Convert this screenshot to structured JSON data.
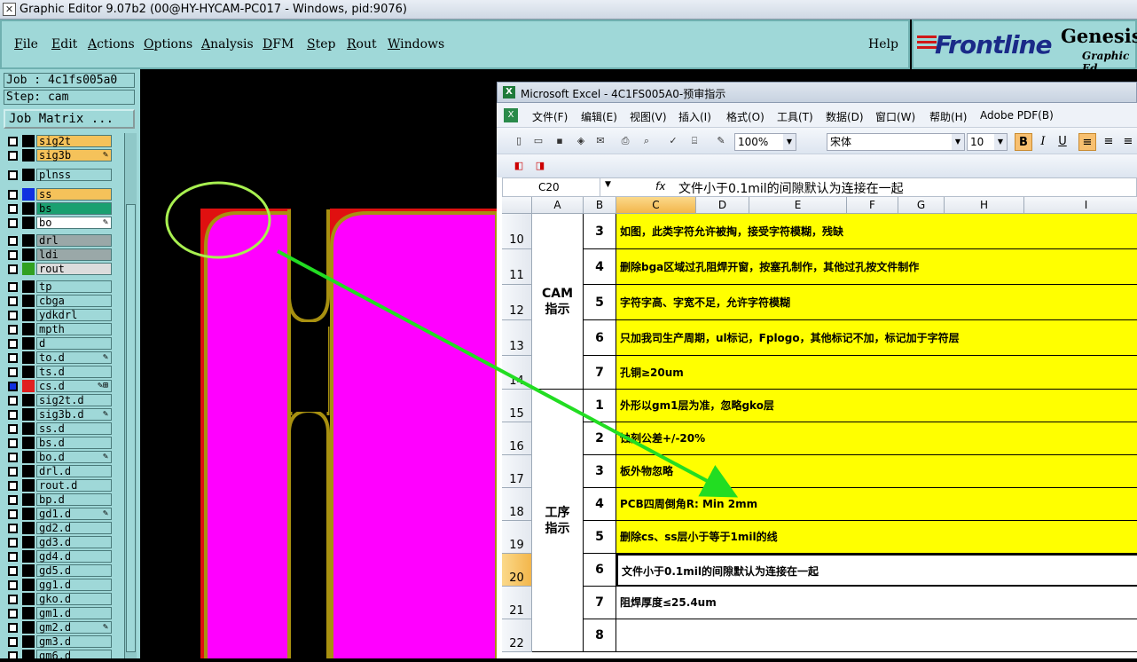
{
  "window_title": "Graphic Editor 9.07b2 (00@HY-HYCAM-PC017 - Windows, pid:9076)",
  "genesis_menu": [
    "File",
    "Edit",
    "Actions",
    "Options",
    "Analysis",
    "DFM",
    "Step",
    "Rout",
    "Windows"
  ],
  "help_label": "Help",
  "logo": {
    "brand": "Frontline",
    "product": "Genesis",
    "subtitle": "Graphic Ed"
  },
  "job_label": "Job : 4c1fs005a0",
  "step_label": "Step: cam",
  "job_matrix_label": "Job Matrix ...",
  "layers": [
    {
      "name": "sig2t",
      "color": "#000000",
      "bg": "#f5c25a",
      "mark": ""
    },
    {
      "name": "sig3b",
      "color": "#000000",
      "bg": "#f5c25a",
      "mark": "✎"
    },
    {
      "name": "plnss",
      "color": "#000000",
      "bg": "#9fd8d8",
      "mark": ""
    },
    {
      "name": "ss",
      "color": "#1030e0",
      "bg": "#f5c25a",
      "mark": ""
    },
    {
      "name": "bs",
      "color": "#000000",
      "bg": "#1aa070",
      "mark": ""
    },
    {
      "name": "bo",
      "color": "#000000",
      "bg": "#ffffff",
      "mark": "✎"
    },
    {
      "name": "drl",
      "color": "#000000",
      "bg": "#9aa8a8",
      "mark": ""
    },
    {
      "name": "ldi",
      "color": "#000000",
      "bg": "#9aa8a8",
      "mark": ""
    },
    {
      "name": "rout",
      "color": "#30a020",
      "bg": "#dcdcdc",
      "mark": ""
    },
    {
      "name": "tp",
      "color": "#000000",
      "bg": "#9fd8d8",
      "mark": ""
    },
    {
      "name": "cbga",
      "color": "#000000",
      "bg": "#9fd8d8",
      "mark": ""
    },
    {
      "name": "ydkdrl",
      "color": "#000000",
      "bg": "#9fd8d8",
      "mark": ""
    },
    {
      "name": "mpth",
      "color": "#000000",
      "bg": "#9fd8d8",
      "mark": ""
    },
    {
      "name": "d",
      "color": "#000000",
      "bg": "#9fd8d8",
      "mark": ""
    },
    {
      "name": "to.d",
      "color": "#000000",
      "bg": "#9fd8d8",
      "mark": "✎"
    },
    {
      "name": "ts.d",
      "color": "#000000",
      "bg": "#9fd8d8",
      "mark": ""
    },
    {
      "name": "cs.d",
      "color": "#e02020",
      "bg": "#9fd8d8",
      "mark": "✎⊞"
    },
    {
      "name": "sig2t.d",
      "color": "#000000",
      "bg": "#9fd8d8",
      "mark": ""
    },
    {
      "name": "sig3b.d",
      "color": "#000000",
      "bg": "#9fd8d8",
      "mark": "✎"
    },
    {
      "name": "ss.d",
      "color": "#000000",
      "bg": "#9fd8d8",
      "mark": ""
    },
    {
      "name": "bs.d",
      "color": "#000000",
      "bg": "#9fd8d8",
      "mark": ""
    },
    {
      "name": "bo.d",
      "color": "#000000",
      "bg": "#9fd8d8",
      "mark": "✎"
    },
    {
      "name": "drl.d",
      "color": "#000000",
      "bg": "#9fd8d8",
      "mark": ""
    },
    {
      "name": "rout.d",
      "color": "#000000",
      "bg": "#9fd8d8",
      "mark": ""
    },
    {
      "name": "bp.d",
      "color": "#000000",
      "bg": "#9fd8d8",
      "mark": ""
    },
    {
      "name": "gd1.d",
      "color": "#000000",
      "bg": "#9fd8d8",
      "mark": "✎"
    },
    {
      "name": "gd2.d",
      "color": "#000000",
      "bg": "#9fd8d8",
      "mark": ""
    },
    {
      "name": "gd3.d",
      "color": "#000000",
      "bg": "#9fd8d8",
      "mark": ""
    },
    {
      "name": "gd4.d",
      "color": "#000000",
      "bg": "#9fd8d8",
      "mark": ""
    },
    {
      "name": "gd5.d",
      "color": "#000000",
      "bg": "#9fd8d8",
      "mark": ""
    },
    {
      "name": "gg1.d",
      "color": "#000000",
      "bg": "#9fd8d8",
      "mark": ""
    },
    {
      "name": "gko.d",
      "color": "#000000",
      "bg": "#9fd8d8",
      "mark": ""
    },
    {
      "name": "gm1.d",
      "color": "#000000",
      "bg": "#9fd8d8",
      "mark": ""
    },
    {
      "name": "gm2.d",
      "color": "#000000",
      "bg": "#9fd8d8",
      "mark": "✎"
    },
    {
      "name": "gm3.d",
      "color": "#000000",
      "bg": "#9fd8d8",
      "mark": ""
    },
    {
      "name": "gm6.d",
      "color": "#000000",
      "bg": "#9fd8d8",
      "mark": ""
    }
  ],
  "excel": {
    "title": "Microsoft Excel - 4C1FS005A0-预审指示",
    "menu": [
      "文件(F)",
      "编辑(E)",
      "视图(V)",
      "插入(I)",
      "格式(O)",
      "工具(T)",
      "数据(D)",
      "窗口(W)",
      "帮助(H)",
      "Adobe PDF(B)"
    ],
    "zoom": "100%",
    "font_name": "宋体",
    "font_size": "10",
    "bold_label": "B",
    "italic_label": "I",
    "underline_label": "U",
    "name_box": "C20",
    "fx_label": "fx",
    "formula_value": "文件小于0.1mil的间隙默认为连接在一起",
    "columns": [
      "A",
      "B",
      "C",
      "D",
      "E",
      "F",
      "G",
      "H",
      "I"
    ],
    "groups": [
      {
        "label": "CAM\n指示"
      },
      {
        "label": "工序\n指示"
      }
    ],
    "rows": [
      {
        "num": "10",
        "b": "3",
        "text": "如图，此类字符允许被掏，接受字符模糊，残缺",
        "yellow": true
      },
      {
        "num": "11",
        "b": "4",
        "text": "删除bga区域过孔阻焊开窗，按塞孔制作，其他过孔按文件制作",
        "yellow": true
      },
      {
        "num": "12",
        "b": "5",
        "text": "字符字高、字宽不足，允许字符模糊",
        "yellow": true
      },
      {
        "num": "13",
        "b": "6",
        "text": "只加我司生产周期，ul标记，Fplogo，其他标记不加，标记加于字符层",
        "yellow": true
      },
      {
        "num": "14",
        "b": "7",
        "text": "孔铜≥20um",
        "yellow": true
      },
      {
        "num": "15",
        "b": "1",
        "text": "外形以gm1层为准，忽略gko层",
        "yellow": true
      },
      {
        "num": "16",
        "b": "2",
        "text": "蚀刻公差+/-20%",
        "yellow": true
      },
      {
        "num": "17",
        "b": "3",
        "text": "板外物忽略",
        "yellow": true
      },
      {
        "num": "18",
        "b": "4",
        "text": "PCB四周倒角R: Min 2mm",
        "yellow": true
      },
      {
        "num": "19",
        "b": "5",
        "text": "删除cs、ss层小于等于1mil的线",
        "yellow": true
      },
      {
        "num": "20",
        "b": "6",
        "text": "文件小于0.1mil的间隙默认为连接在一起",
        "yellow": false
      },
      {
        "num": "21",
        "b": "7",
        "text": "阻焊厚度≤25.4um",
        "yellow": false
      },
      {
        "num": "22",
        "b": "8",
        "text": "",
        "yellow": false
      }
    ]
  },
  "colors": {
    "genesis_panel": "#9fd8d8",
    "cell_yellow": "#ffff00",
    "magenta": "#ff00ff",
    "outline": "#a89010",
    "arrow": "#22dd22"
  }
}
